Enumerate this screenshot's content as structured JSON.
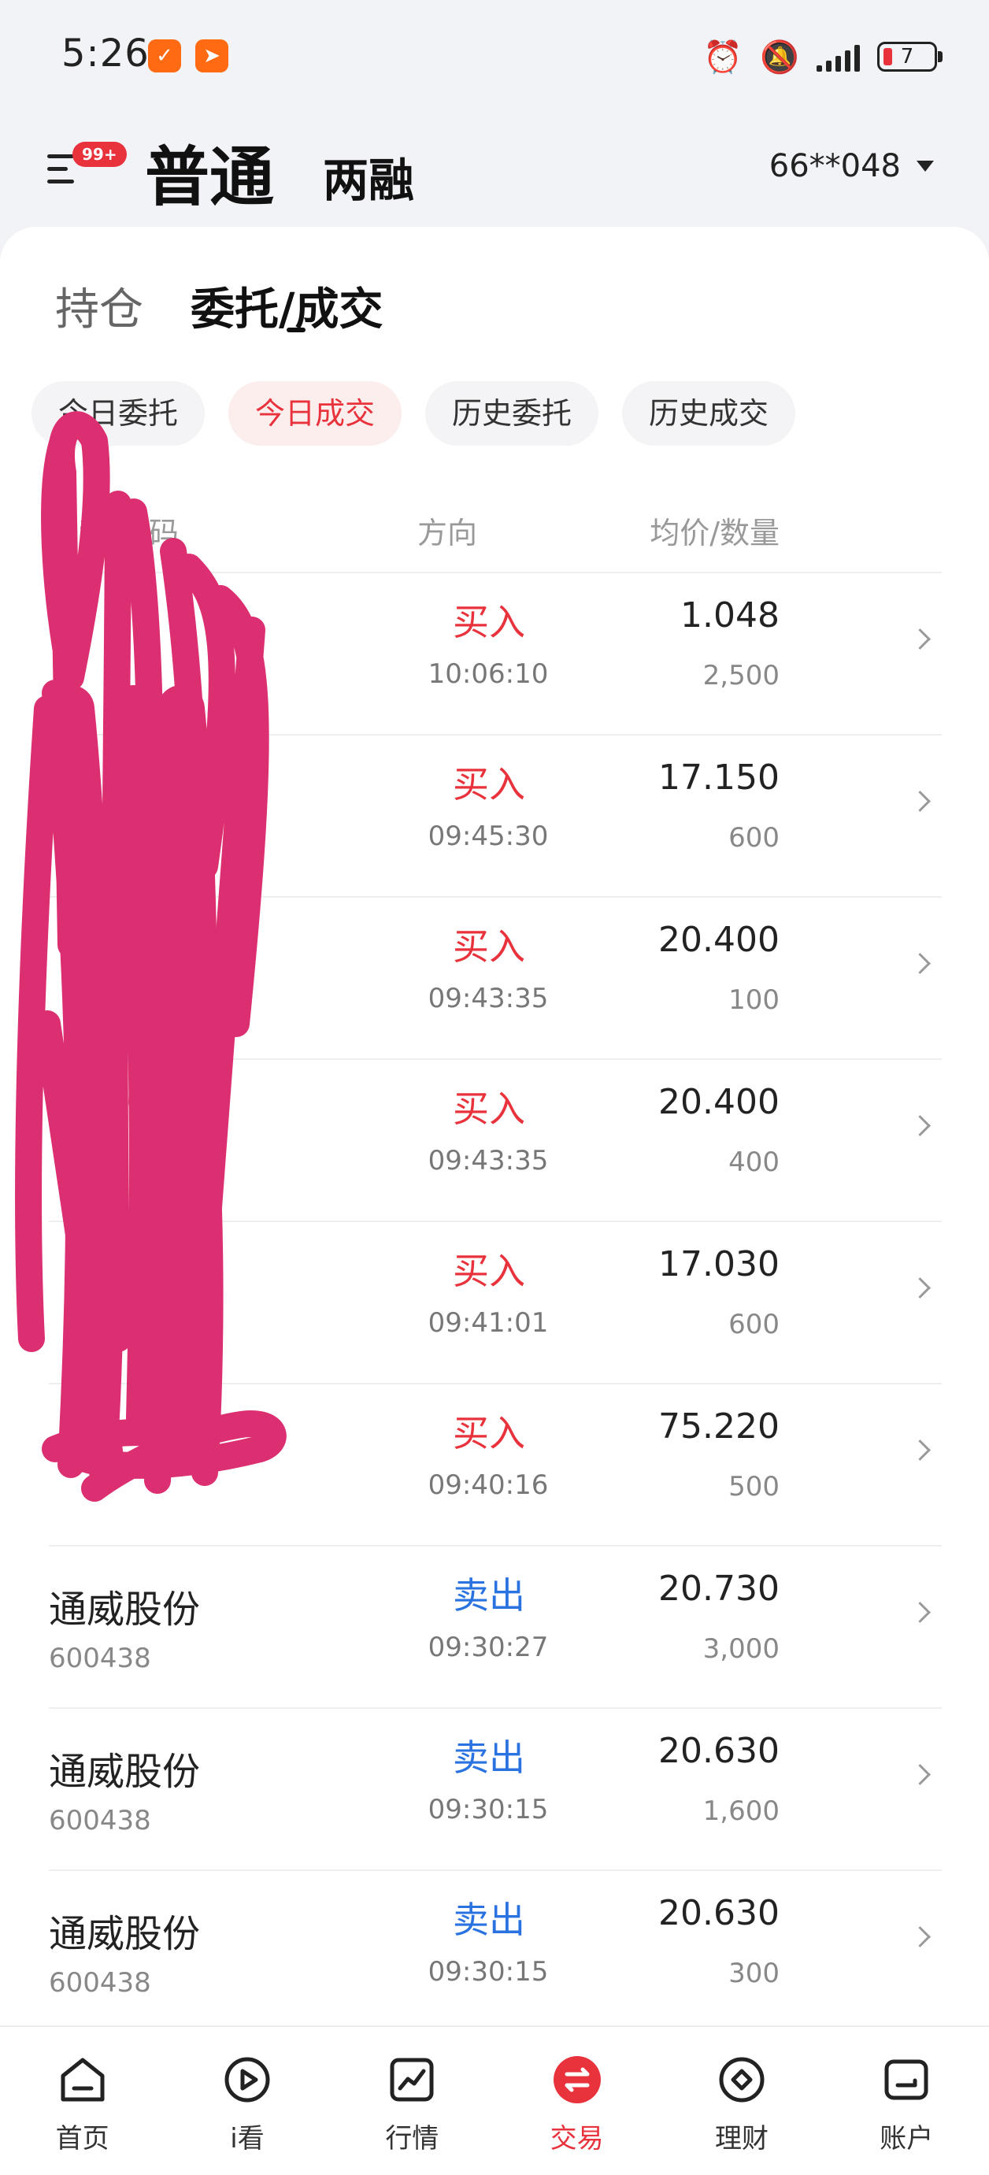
{
  "status_bar": {
    "time": "5:26",
    "battery": "7"
  },
  "header": {
    "menu_badge": "99+",
    "mode_normal": "普通",
    "mode_margin": "两融",
    "account": "66**048"
  },
  "subtabs": {
    "holdings": "持仓",
    "orders": "委托/成交"
  },
  "chips": [
    {
      "label": "今日委托",
      "active": false
    },
    {
      "label": "今日成交",
      "active": true
    },
    {
      "label": "历史委托",
      "active": false
    },
    {
      "label": "历史成交",
      "active": false
    }
  ],
  "columns": {
    "name": "名称/代码",
    "direction": "方向",
    "price_qty": "均价/数量"
  },
  "rows": [
    {
      "name": "",
      "code": "",
      "direction": "买入",
      "type": "buy",
      "time": "10:06:10",
      "price": "1.048",
      "qty": "2,500"
    },
    {
      "name": "",
      "code": "",
      "direction": "买入",
      "type": "buy",
      "time": "09:45:30",
      "price": "17.150",
      "qty": "600"
    },
    {
      "name": "",
      "code": "",
      "direction": "买入",
      "type": "buy",
      "time": "09:43:35",
      "price": "20.400",
      "qty": "100"
    },
    {
      "name": "",
      "code": "",
      "direction": "买入",
      "type": "buy",
      "time": "09:43:35",
      "price": "20.400",
      "qty": "400"
    },
    {
      "name": "",
      "code": "",
      "direction": "买入",
      "type": "buy",
      "time": "09:41:01",
      "price": "17.030",
      "qty": "600"
    },
    {
      "name": "",
      "code": "",
      "direction": "买入",
      "type": "buy",
      "time": "09:40:16",
      "price": "75.220",
      "qty": "500"
    },
    {
      "name": "通威股份",
      "code": "600438",
      "direction": "卖出",
      "type": "sell",
      "time": "09:30:27",
      "price": "20.730",
      "qty": "3,000"
    },
    {
      "name": "通威股份",
      "code": "600438",
      "direction": "卖出",
      "type": "sell",
      "time": "09:30:15",
      "price": "20.630",
      "qty": "1,600"
    },
    {
      "name": "通威股份",
      "code": "600438",
      "direction": "卖出",
      "type": "sell",
      "time": "09:30:15",
      "price": "20.630",
      "qty": "300"
    }
  ],
  "bottom_nav": [
    {
      "label": "首页",
      "icon": "home-icon",
      "active": false
    },
    {
      "label": "i看",
      "icon": "play-icon",
      "active": false
    },
    {
      "label": "行情",
      "icon": "chart-icon",
      "active": false
    },
    {
      "label": "交易",
      "icon": "trade-icon",
      "active": true
    },
    {
      "label": "理财",
      "icon": "wealth-icon",
      "active": false
    },
    {
      "label": "账户",
      "icon": "account-icon",
      "active": false
    }
  ],
  "colors": {
    "buy": "#e8323c",
    "sell": "#2a72e0",
    "accent": "#e8323c",
    "scribble": "#dc2f72"
  }
}
